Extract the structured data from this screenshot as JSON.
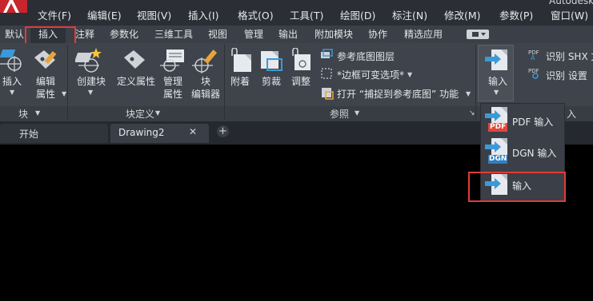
{
  "menubar": {
    "items": [
      "文件(F)",
      "编辑(E)",
      "视图(V)",
      "插入(I)",
      "格式(O)",
      "工具(T)",
      "绘图(D)",
      "标注(N)",
      "修改(M)",
      "参数(P)",
      "窗口(W)"
    ],
    "title_partial": "Autodesk"
  },
  "ribbon_tabs": {
    "items": [
      "默认",
      "插入",
      "注释",
      "参数化",
      "三维工具",
      "视图",
      "管理",
      "输出",
      "附加模块",
      "协作",
      "精选应用"
    ],
    "active": "插入"
  },
  "block_panel": {
    "insert_label": "插入",
    "edit_attr_label_1": "编辑",
    "edit_attr_label_2": "属性",
    "panel_title": "块"
  },
  "block_def_panel": {
    "create_label": "创建块",
    "define_attr_label": "定义属性",
    "manage_attr_1": "管理",
    "manage_attr_2": "属性",
    "block_editor_1": "块",
    "block_editor_2": "编辑器",
    "panel_title": "块定义"
  },
  "reference_panel": {
    "attach_label": "附着",
    "clip_label": "剪裁",
    "adjust_label": "调整",
    "underlay_layers": "参考底图图层",
    "frame_option": "*边框可变选项*",
    "snap_option": "打开 “捕捉到参考底图” 功能",
    "panel_title": "参照"
  },
  "import_panel": {
    "import_label": "输入",
    "recognize_shx": "识别 SHX 文",
    "recognize_settings": "识别 设置",
    "panel_title_partial": "入"
  },
  "dropdown": {
    "items": [
      "PDF 输入",
      "DGN 输入",
      "输入"
    ],
    "pdf_tag": "PDF",
    "dgn_tag": "DGN"
  },
  "file_tabs": {
    "start_label": "开始",
    "drawing_label": "Drawing2",
    "close_symbol": "✕",
    "add_symbol": "+"
  },
  "colors": {
    "highlight_red": "#e23b36",
    "ribbon_bg": "#3f434b",
    "menubar_bg": "#2b2e35",
    "icon_blue": "#3a9ad9",
    "pdf_red": "#e0463c",
    "dgn_blue": "#2f7fc1"
  }
}
